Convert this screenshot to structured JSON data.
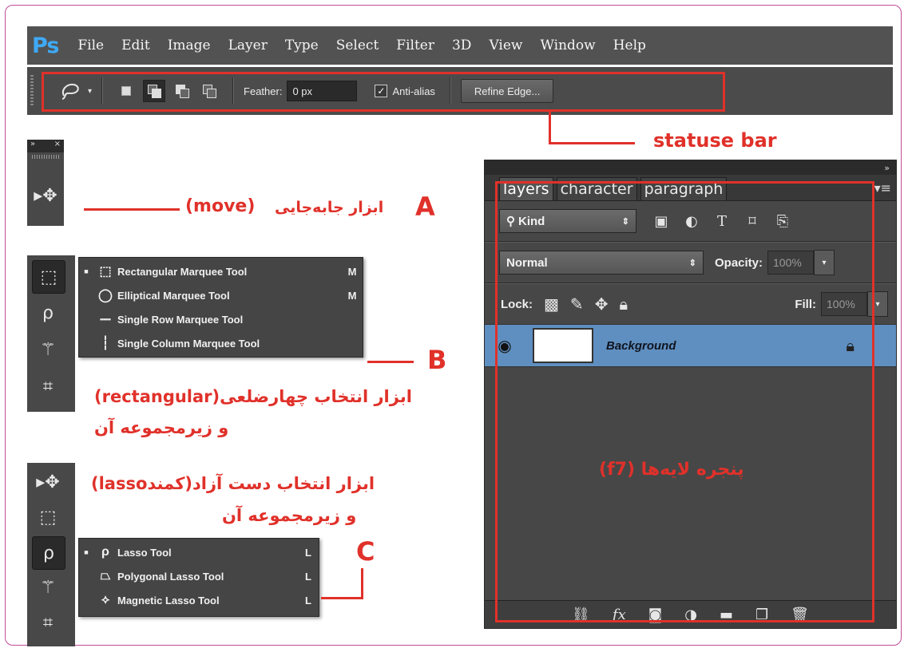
{
  "menubar": {
    "logo": "Ps",
    "items": [
      "File",
      "Edit",
      "Image",
      "Layer",
      "Type",
      "Select",
      "Filter",
      "3D",
      "View",
      "Window",
      "Help"
    ]
  },
  "options_bar": {
    "feather_label": "Feather:",
    "feather_value": "0 px",
    "anti_alias_label": "Anti-alias",
    "refine_edge_label": "Refine Edge..."
  },
  "callouts": {
    "status_bar": "statuse bar",
    "a_letter": "A",
    "a_text": "ابزار جابه‌جایی",
    "a_en": "(move)",
    "b_letter": "B",
    "b_line1": "ابزار انتخاب چهارضلعی(rectangular)",
    "b_line2": "و زیرمجموعه آن",
    "c_letter": "C",
    "c_line1": "ابزار انتخاب دست آزاد(کمندlasso)",
    "c_line2": "و زیرمجموعه آن",
    "layers_window": "پنجره لایه‌ها (f7)"
  },
  "marquee_flyout": [
    {
      "label": "Rectangular Marquee Tool",
      "key": "M",
      "icon": "rect-marquee-icon"
    },
    {
      "label": "Elliptical Marquee Tool",
      "key": "M",
      "icon": "ellipse-marquee-icon"
    },
    {
      "label": "Single Row Marquee Tool",
      "key": "",
      "icon": "single-row-icon"
    },
    {
      "label": "Single Column Marquee Tool",
      "key": "",
      "icon": "single-column-icon"
    }
  ],
  "lasso_flyout": [
    {
      "label": "Lasso Tool",
      "key": "L",
      "icon": "lasso-icon"
    },
    {
      "label": "Polygonal Lasso Tool",
      "key": "L",
      "icon": "polygonal-lasso-icon"
    },
    {
      "label": "Magnetic Lasso Tool",
      "key": "L",
      "icon": "magnetic-lasso-icon"
    }
  ],
  "layers_panel": {
    "tabs": [
      "layers",
      "character",
      "paragraph"
    ],
    "kind_label": "Kind",
    "blend_mode": "Normal",
    "opacity_label": "Opacity:",
    "opacity_value": "100%",
    "lock_label": "Lock:",
    "fill_label": "Fill:",
    "fill_value": "100%",
    "layer_name": "Background"
  },
  "colors": {
    "accent_red": "#e0312a",
    "ps_blue": "#3fa9f5",
    "layer_selected": "#5f8fc0"
  }
}
